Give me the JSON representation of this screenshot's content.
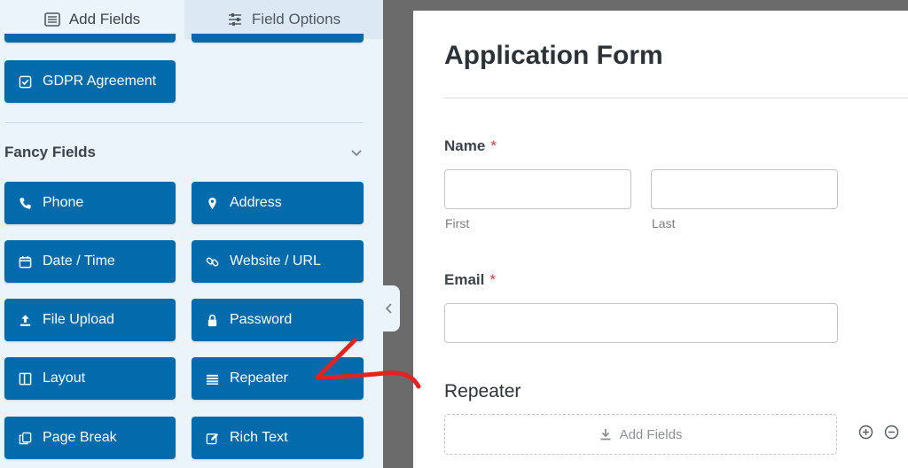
{
  "tabs": {
    "add_fields": "Add Fields",
    "field_options": "Field Options"
  },
  "standard_fields_tail": {
    "gdpr_label": "GDPR Agreement"
  },
  "fancy_fields": {
    "title": "Fancy Fields",
    "buttons": [
      {
        "label": "Phone",
        "icon": "phone-icon"
      },
      {
        "label": "Address",
        "icon": "map-pin-icon"
      },
      {
        "label": "Date / Time",
        "icon": "calendar-icon"
      },
      {
        "label": "Website / URL",
        "icon": "link-icon"
      },
      {
        "label": "File Upload",
        "icon": "upload-icon"
      },
      {
        "label": "Password",
        "icon": "lock-icon"
      },
      {
        "label": "Layout",
        "icon": "layout-icon"
      },
      {
        "label": "Repeater",
        "icon": "repeater-icon"
      },
      {
        "label": "Page Break",
        "icon": "copy-icon"
      },
      {
        "label": "Rich Text",
        "icon": "edit-icon"
      }
    ]
  },
  "form": {
    "title": "Application Form",
    "name_label": "Name",
    "required_mark": "*",
    "first_sublabel": "First",
    "last_sublabel": "Last",
    "email_label": "Email",
    "repeater_label": "Repeater",
    "add_fields_label": "Add Fields"
  },
  "colors": {
    "button_blue": "#036aab",
    "panel_bg": "#ebf3fb",
    "annotation_red": "#e02424"
  }
}
